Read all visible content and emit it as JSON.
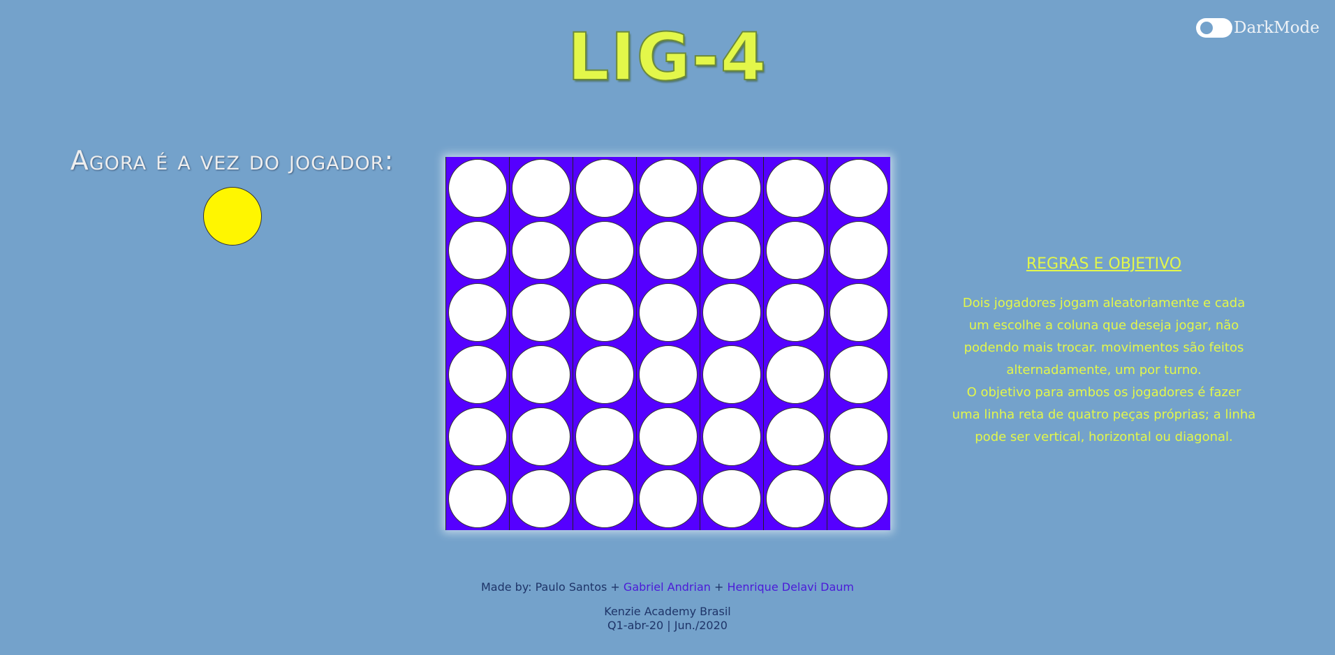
{
  "darkmode": {
    "label": "DarkMode",
    "enabled": false
  },
  "title": "LIG-4",
  "turn": {
    "label": "Agora é a vez do jogador:",
    "current_player_color": "#fff600"
  },
  "board": {
    "columns": 7,
    "rows": 6,
    "board_color": "#5500ff",
    "empty_color": "#ffffff"
  },
  "rules": {
    "title": "REGRAS E OBJETIVO",
    "lines": [
      "Dois jogadores jogam aleatoriamente e cada",
      "um escolhe a coluna que deseja jogar, não",
      "podendo mais trocar. movimentos são feitos",
      "alternadamente, um por turno.",
      "O objetivo para ambos os jogadores é fazer",
      "uma linha reta de quatro peças próprias; a linha",
      "pode ser vertical, horizontal ou diagonal."
    ]
  },
  "footer": {
    "made_by": "Made by:",
    "author1": "Paulo Santos",
    "sep": "+",
    "author2": "Gabriel Andrian",
    "author3": "Henrique Delavi Daum",
    "school": "Kenzie Academy Brasil",
    "cohort": "Q1-abr-20 | Jun./2020"
  }
}
